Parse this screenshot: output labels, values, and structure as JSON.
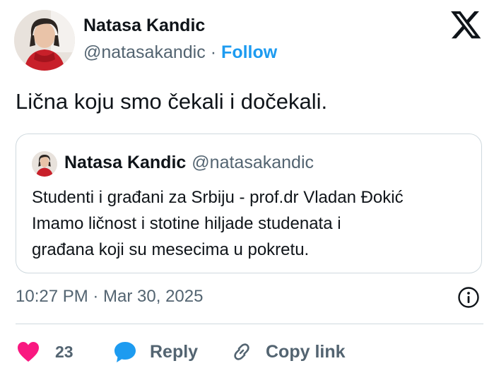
{
  "author": {
    "name": "Natasa Kandic",
    "handle": "@natasakandic",
    "separator": "·",
    "follow_label": "Follow"
  },
  "tweet": {
    "text": "Lična koju smo čekali i dočekali."
  },
  "quote": {
    "name": "Natasa Kandic",
    "handle": "@natasakandic",
    "lines": [
      "Studenti i građani za Srbiju - prof.dr Vladan Đokić",
      "Imamo ličnost i stotine hiljade studenata i",
      "građana koji su mesecima u pokretu."
    ]
  },
  "timestamp": "10:27 PM · Mar 30, 2025",
  "actions": {
    "like_count": "23",
    "reply_label": "Reply",
    "copy_label": "Copy link"
  },
  "icons": {
    "brand": "x-logo-icon",
    "info": "info-icon",
    "like": "heart-icon",
    "reply": "speech-bubble-icon",
    "copy": "link-icon"
  },
  "colors": {
    "accent": "#1d9bf0",
    "heart": "#f91880",
    "text": "#0f1419",
    "muted": "#536471",
    "border": "#cfd9de"
  }
}
